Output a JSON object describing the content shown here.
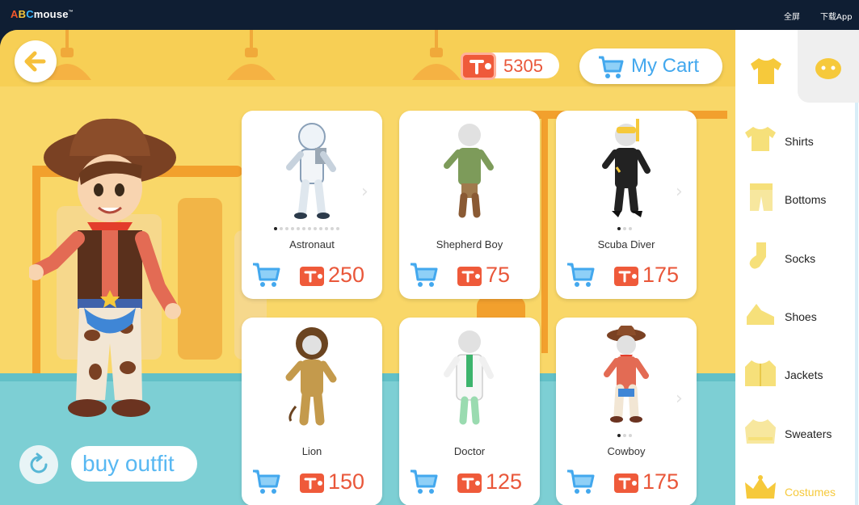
{
  "topbar": {
    "logo_a": "A",
    "logo_b": "B",
    "logo_c": "C",
    "logo_rest": "mouse",
    "logo_tm": "™",
    "fullscreen": "全屏",
    "download_app": "下载App"
  },
  "stage": {
    "back_icon": "arrow-left-icon",
    "tickets": "5305",
    "cart_label": "My Cart",
    "buy_outfit": "buy outfit",
    "reset_icon": "refresh-icon"
  },
  "cards": [
    {
      "name": "Astronaut",
      "price": "250"
    },
    {
      "name": "Shepherd Boy",
      "price": "75"
    },
    {
      "name": "Scuba Diver",
      "price": "175"
    },
    {
      "name": "Lion",
      "price": "150"
    },
    {
      "name": "Doctor",
      "price": "125"
    },
    {
      "name": "Cowboy",
      "price": "175"
    }
  ],
  "side": {
    "categories": [
      {
        "label": "Shirts"
      },
      {
        "label": "Bottoms"
      },
      {
        "label": "Socks"
      },
      {
        "label": "Shoes"
      },
      {
        "label": "Jackets"
      },
      {
        "label": "Sweaters"
      },
      {
        "label": "Costumes"
      }
    ],
    "active_category": "Costumes"
  },
  "colors": {
    "accent_blue": "#43a8ee",
    "ticket_red": "#e9573a",
    "clothing_yellow": "#f6c93b"
  }
}
